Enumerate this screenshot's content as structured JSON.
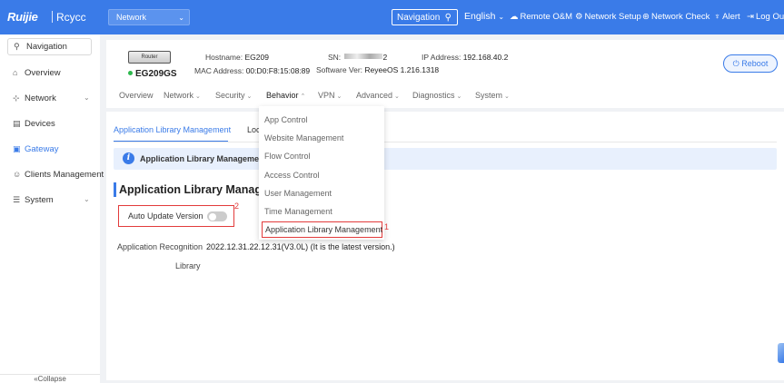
{
  "topbar": {
    "logo": "Ruijie",
    "logo_sub": "Rcycc",
    "network_select": "Network",
    "navigation": "Navigation",
    "language": "English",
    "remote_om": "Remote O&M",
    "network_setup": "Network Setup",
    "network_check": "Network Check",
    "alert": "Alert",
    "logout": "Log Out"
  },
  "sidebar": {
    "search": "Navigation",
    "items": [
      {
        "label": "Overview"
      },
      {
        "label": "Network"
      },
      {
        "label": "Devices"
      },
      {
        "label": "Gateway"
      },
      {
        "label": "Clients Management"
      },
      {
        "label": "System"
      }
    ],
    "collapse": "«Collapse"
  },
  "device": {
    "image_label": "Router",
    "model": "EG209GS",
    "hostname_label": "Hostname:",
    "hostname": "EG209",
    "mac_label": "MAC Address:",
    "mac": "00:D0:F8:15:08:89",
    "sn_label": "SN:",
    "sn_suffix": "2",
    "software_label": "Software Ver:",
    "software": "ReyeeOS 1.216.1318",
    "ip_label": "IP Address:",
    "ip": "192.168.40.2",
    "reboot": "Reboot"
  },
  "tabs": [
    {
      "label": "Overview"
    },
    {
      "label": "Network"
    },
    {
      "label": "Security"
    },
    {
      "label": "Behavior"
    },
    {
      "label": "VPN"
    },
    {
      "label": "Advanced"
    },
    {
      "label": "Diagnostics"
    },
    {
      "label": "System"
    }
  ],
  "dropdown": {
    "items": [
      {
        "label": "App Control"
      },
      {
        "label": "Website Management"
      },
      {
        "label": "Flow Control"
      },
      {
        "label": "Access Control"
      },
      {
        "label": "User Management"
      },
      {
        "label": "Time Management"
      },
      {
        "label": "Application Library Management"
      }
    ]
  },
  "main": {
    "subtabs": [
      {
        "label": "Application Library Management"
      },
      {
        "label": "Loc"
      }
    ],
    "info_text": "Application Library Management",
    "section_title": "Application Library Manageme",
    "auto_update_label": "Auto Update Version",
    "auto_update_on": false,
    "recognition_label_1": "Application Recognition",
    "recognition_label_2": "Library",
    "recognition_value": "2022.12.31.22.12.31(V3.0L) (It is the latest version.)",
    "marker_1": "1",
    "marker_2": "2"
  },
  "colors": {
    "primary": "#3a7be8",
    "highlight_border": "#e23b3b",
    "online": "#2db84d"
  }
}
